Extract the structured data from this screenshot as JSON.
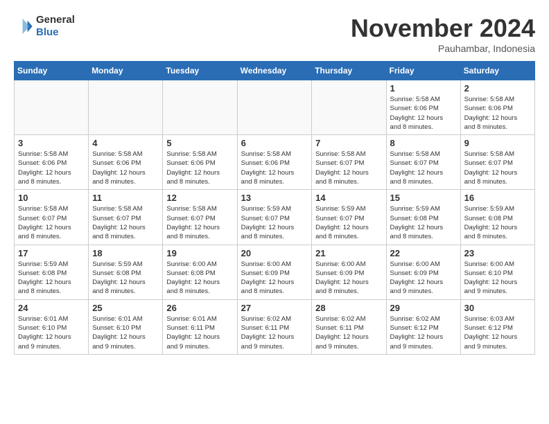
{
  "header": {
    "logo_line1": "General",
    "logo_line2": "Blue",
    "month": "November 2024",
    "location": "Pauhambar, Indonesia"
  },
  "weekdays": [
    "Sunday",
    "Monday",
    "Tuesday",
    "Wednesday",
    "Thursday",
    "Friday",
    "Saturday"
  ],
  "weeks": [
    [
      {
        "day": "",
        "info": ""
      },
      {
        "day": "",
        "info": ""
      },
      {
        "day": "",
        "info": ""
      },
      {
        "day": "",
        "info": ""
      },
      {
        "day": "",
        "info": ""
      },
      {
        "day": "1",
        "info": "Sunrise: 5:58 AM\nSunset: 6:06 PM\nDaylight: 12 hours\nand 8 minutes."
      },
      {
        "day": "2",
        "info": "Sunrise: 5:58 AM\nSunset: 6:06 PM\nDaylight: 12 hours\nand 8 minutes."
      }
    ],
    [
      {
        "day": "3",
        "info": "Sunrise: 5:58 AM\nSunset: 6:06 PM\nDaylight: 12 hours\nand 8 minutes."
      },
      {
        "day": "4",
        "info": "Sunrise: 5:58 AM\nSunset: 6:06 PM\nDaylight: 12 hours\nand 8 minutes."
      },
      {
        "day": "5",
        "info": "Sunrise: 5:58 AM\nSunset: 6:06 PM\nDaylight: 12 hours\nand 8 minutes."
      },
      {
        "day": "6",
        "info": "Sunrise: 5:58 AM\nSunset: 6:06 PM\nDaylight: 12 hours\nand 8 minutes."
      },
      {
        "day": "7",
        "info": "Sunrise: 5:58 AM\nSunset: 6:07 PM\nDaylight: 12 hours\nand 8 minutes."
      },
      {
        "day": "8",
        "info": "Sunrise: 5:58 AM\nSunset: 6:07 PM\nDaylight: 12 hours\nand 8 minutes."
      },
      {
        "day": "9",
        "info": "Sunrise: 5:58 AM\nSunset: 6:07 PM\nDaylight: 12 hours\nand 8 minutes."
      }
    ],
    [
      {
        "day": "10",
        "info": "Sunrise: 5:58 AM\nSunset: 6:07 PM\nDaylight: 12 hours\nand 8 minutes."
      },
      {
        "day": "11",
        "info": "Sunrise: 5:58 AM\nSunset: 6:07 PM\nDaylight: 12 hours\nand 8 minutes."
      },
      {
        "day": "12",
        "info": "Sunrise: 5:58 AM\nSunset: 6:07 PM\nDaylight: 12 hours\nand 8 minutes."
      },
      {
        "day": "13",
        "info": "Sunrise: 5:59 AM\nSunset: 6:07 PM\nDaylight: 12 hours\nand 8 minutes."
      },
      {
        "day": "14",
        "info": "Sunrise: 5:59 AM\nSunset: 6:07 PM\nDaylight: 12 hours\nand 8 minutes."
      },
      {
        "day": "15",
        "info": "Sunrise: 5:59 AM\nSunset: 6:08 PM\nDaylight: 12 hours\nand 8 minutes."
      },
      {
        "day": "16",
        "info": "Sunrise: 5:59 AM\nSunset: 6:08 PM\nDaylight: 12 hours\nand 8 minutes."
      }
    ],
    [
      {
        "day": "17",
        "info": "Sunrise: 5:59 AM\nSunset: 6:08 PM\nDaylight: 12 hours\nand 8 minutes."
      },
      {
        "day": "18",
        "info": "Sunrise: 5:59 AM\nSunset: 6:08 PM\nDaylight: 12 hours\nand 8 minutes."
      },
      {
        "day": "19",
        "info": "Sunrise: 6:00 AM\nSunset: 6:08 PM\nDaylight: 12 hours\nand 8 minutes."
      },
      {
        "day": "20",
        "info": "Sunrise: 6:00 AM\nSunset: 6:09 PM\nDaylight: 12 hours\nand 8 minutes."
      },
      {
        "day": "21",
        "info": "Sunrise: 6:00 AM\nSunset: 6:09 PM\nDaylight: 12 hours\nand 8 minutes."
      },
      {
        "day": "22",
        "info": "Sunrise: 6:00 AM\nSunset: 6:09 PM\nDaylight: 12 hours\nand 9 minutes."
      },
      {
        "day": "23",
        "info": "Sunrise: 6:00 AM\nSunset: 6:10 PM\nDaylight: 12 hours\nand 9 minutes."
      }
    ],
    [
      {
        "day": "24",
        "info": "Sunrise: 6:01 AM\nSunset: 6:10 PM\nDaylight: 12 hours\nand 9 minutes."
      },
      {
        "day": "25",
        "info": "Sunrise: 6:01 AM\nSunset: 6:10 PM\nDaylight: 12 hours\nand 9 minutes."
      },
      {
        "day": "26",
        "info": "Sunrise: 6:01 AM\nSunset: 6:11 PM\nDaylight: 12 hours\nand 9 minutes."
      },
      {
        "day": "27",
        "info": "Sunrise: 6:02 AM\nSunset: 6:11 PM\nDaylight: 12 hours\nand 9 minutes."
      },
      {
        "day": "28",
        "info": "Sunrise: 6:02 AM\nSunset: 6:11 PM\nDaylight: 12 hours\nand 9 minutes."
      },
      {
        "day": "29",
        "info": "Sunrise: 6:02 AM\nSunset: 6:12 PM\nDaylight: 12 hours\nand 9 minutes."
      },
      {
        "day": "30",
        "info": "Sunrise: 6:03 AM\nSunset: 6:12 PM\nDaylight: 12 hours\nand 9 minutes."
      }
    ]
  ]
}
